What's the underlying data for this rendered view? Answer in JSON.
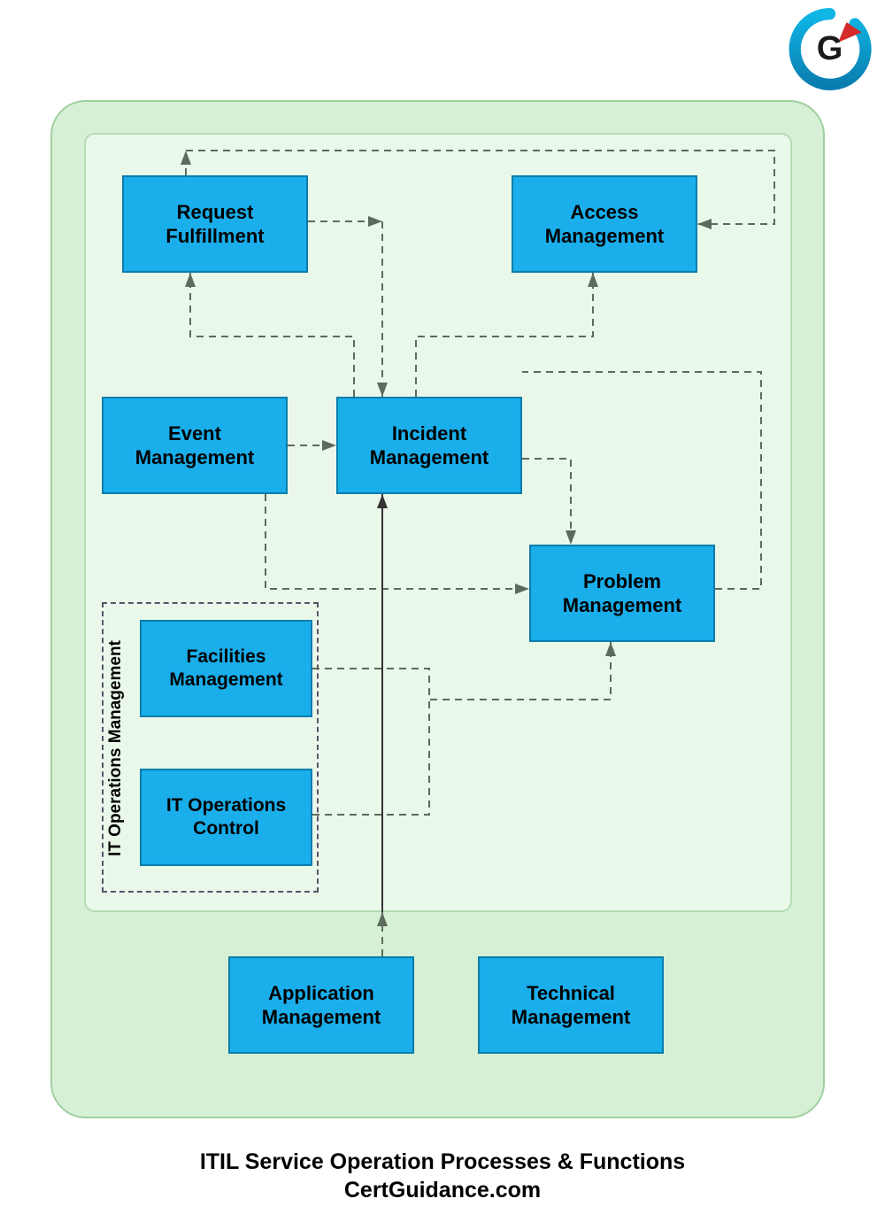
{
  "logo": {
    "letter": "G"
  },
  "boxes": {
    "request": "Request\nFulfillment",
    "access": "Access\nManagement",
    "event": "Event\nManagement",
    "incident": "Incident\nManagement",
    "problem": "Problem\nManagement",
    "facilities": "Facilities\nManagement",
    "itops_control": "IT Operations\nControl",
    "application": "Application\nManagement",
    "technical": "Technical\nManagement"
  },
  "itops_group_label": "IT Operations Management",
  "caption_line1": "ITIL Service Operation Processes & Functions",
  "caption_line2": "CertGuidance.com",
  "colors": {
    "box_fill": "#1aaeeb",
    "box_border": "#0a7dab",
    "outer_bg": "#d6f0d6",
    "inner_bg": "#eaf8ea",
    "dash": "#5c6b5c"
  }
}
